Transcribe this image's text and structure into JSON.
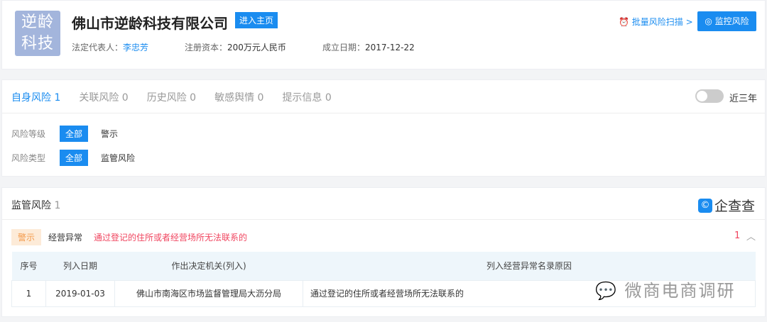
{
  "company": {
    "logo_text": [
      "逆龄",
      "科技"
    ],
    "name": "佛山市逆龄科技有限公司",
    "home_button": "进入主页",
    "legal_rep_label": "法定代表人：",
    "legal_rep": "李忠芳",
    "capital_label": "注册资本：",
    "capital": "200万元人民币",
    "founded_label": "成立日期：",
    "founded": "2017-12-22"
  },
  "actions": {
    "scan": "批量风险扫描 >",
    "monitor": "监控风险"
  },
  "tabs": [
    {
      "label": "自身风险 1"
    },
    {
      "label": "关联风险 0"
    },
    {
      "label": "历史风险 0"
    },
    {
      "label": "敏感舆情 0"
    },
    {
      "label": "提示信息 0"
    }
  ],
  "toggle": {
    "label": "近三年",
    "on": false
  },
  "filters": [
    {
      "label": "风险等级",
      "all": "全部",
      "option": "警示"
    },
    {
      "label": "风险类型",
      "all": "全部",
      "option": "监管风险"
    }
  ],
  "section": {
    "title": "监管风险",
    "count": "1",
    "brand": "企查查",
    "brand_icon": "©",
    "item": {
      "tag": "警示",
      "type": "经营异常",
      "desc": "通过登记的住所或者经营场所无法联系的",
      "count": "1"
    },
    "columns": [
      "序号",
      "列入日期",
      "作出决定机关(列入)",
      "列入经营异常名录原因"
    ],
    "rows": [
      [
        "1",
        "2019-01-03",
        "佛山市南海区市场监督管理局大沥分局",
        "通过登记的住所或者经营场所无法联系的"
      ]
    ]
  },
  "watermark": "微商电商调研"
}
